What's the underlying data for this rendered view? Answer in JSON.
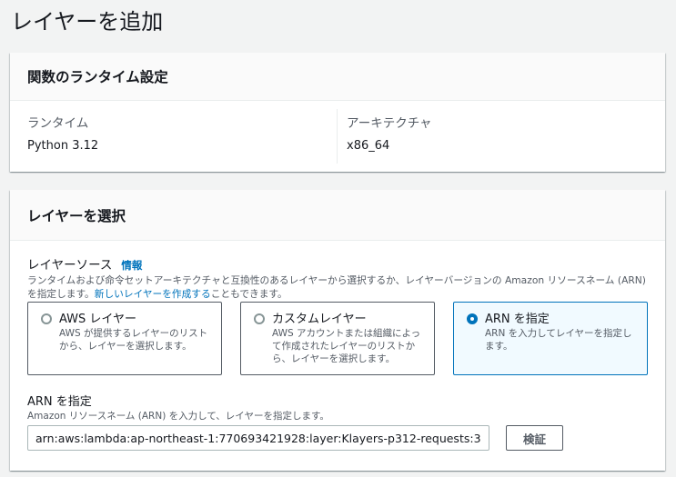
{
  "page": {
    "title": "レイヤーを追加"
  },
  "runtime_settings": {
    "header": "関数のランタイム設定",
    "runtime_label": "ランタイム",
    "runtime_value": "Python 3.12",
    "architecture_label": "アーキテクチャ",
    "architecture_value": "x86_64"
  },
  "choose_layer": {
    "header": "レイヤーを選択",
    "source_label": "レイヤーソース",
    "info_link": "情報",
    "description_part1": "ランタイムおよび命令セットアーキテクチャと互換性のあるレイヤーから選択するか、レイヤーバージョンの Amazon リソースネーム (ARN) を指定します。",
    "description_link": "新しいレイヤーを作成する",
    "description_part2": "こともできます。",
    "options": [
      {
        "title": "AWS レイヤー",
        "description": "AWS が提供するレイヤーのリストから、レイヤーを選択します。",
        "selected": false
      },
      {
        "title": "カスタムレイヤー",
        "description": "AWS アカウントまたは組織によって作成されたレイヤーのリストから、レイヤーを選択します。",
        "selected": false
      },
      {
        "title": "ARN を指定",
        "description": "ARN を入力してレイヤーを指定します。",
        "selected": true
      }
    ],
    "arn_label": "ARN を指定",
    "arn_description": "Amazon リソースネーム (ARN) を入力して、レイヤーを指定します。",
    "arn_value": "arn:aws:lambda:ap-northeast-1:770693421928:layer:Klayers-p312-requests:3",
    "verify_button": "検証"
  },
  "colors": {
    "accent": "#0073bb",
    "selected_tile_bg": "#f1faff",
    "page_bg": "#f2f3f3"
  }
}
